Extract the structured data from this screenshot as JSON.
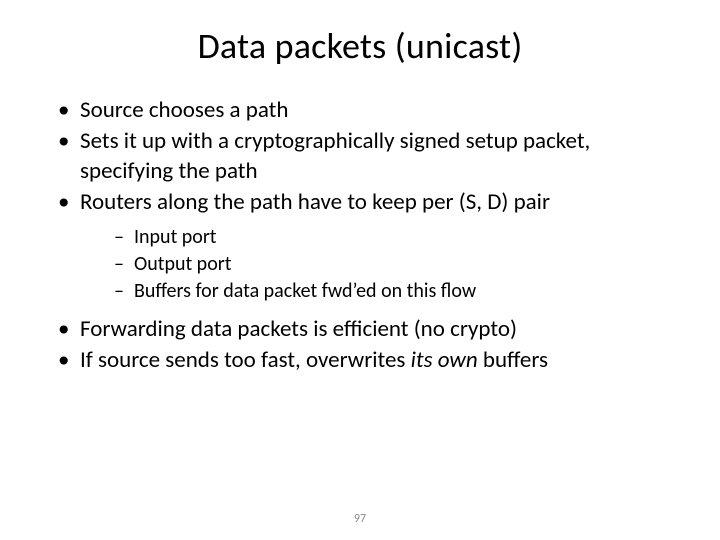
{
  "title": "Data packets (unicast)",
  "bullets": {
    "b0": "Source chooses a path",
    "b1": "Sets it up with a cryptographically signed setup packet, specifying the path",
    "b2": "Routers along the path have to keep per (S, D) pair",
    "sub": {
      "s0": "Input port",
      "s1": "Output port",
      "s2": "Buffers for data packet fwd’ed on this flow"
    },
    "b3": "Forwarding data packets is efficient (no crypto)",
    "b4_pre": "If source sends too fast, overwrites ",
    "b4_em": "its own",
    "b4_post": " buffers"
  },
  "page_number": "97"
}
